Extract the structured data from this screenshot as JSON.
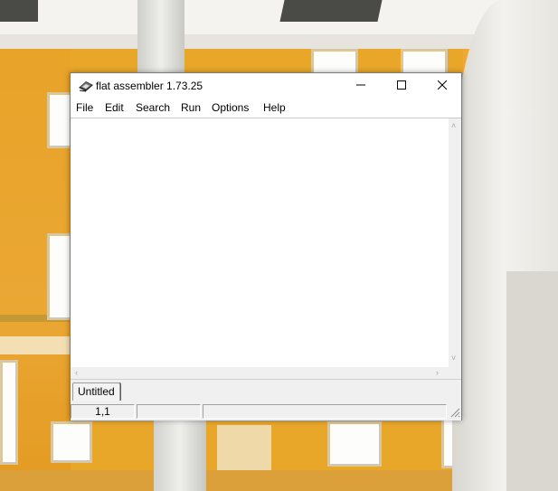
{
  "window": {
    "title": "flat assembler 1.73.25",
    "icon": "fasm-app-icon"
  },
  "caption_buttons": {
    "minimize_icon": "minimize-icon",
    "maximize_icon": "maximize-icon",
    "close_icon": "close-icon"
  },
  "menu": {
    "items": [
      "File",
      "Edit",
      "Search",
      "Run",
      "Options",
      "Help"
    ]
  },
  "editor": {
    "content": ""
  },
  "tabs": [
    {
      "label": "Untitled",
      "active": true
    }
  ],
  "status": {
    "position": "1,1",
    "cell2": "",
    "cell3": ""
  },
  "colors": {
    "window_bg": "#f0f0f0",
    "editor_bg": "#ffffff",
    "wallpaper_yellow": "#e9a72a"
  }
}
